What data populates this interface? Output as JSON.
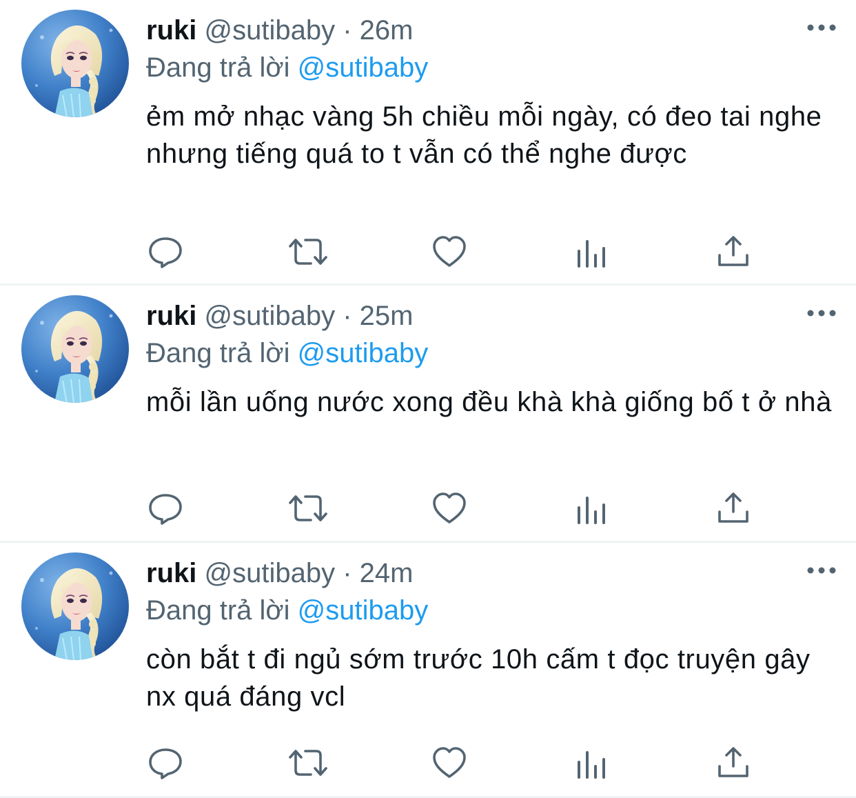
{
  "tweets": [
    {
      "name": "ruki",
      "handle": "@sutibaby",
      "time": "26m",
      "replying_prefix": "Đang trả lời",
      "replying_to": "@sutibaby",
      "text": "ẻm mở nhạc vàng 5h chiều mỗi ngày, có đeo tai nghe nhưng tiếng quá to t vẫn có thể nghe được"
    },
    {
      "name": "ruki",
      "handle": "@sutibaby",
      "time": "25m",
      "replying_prefix": "Đang trả lời",
      "replying_to": "@sutibaby",
      "text": "mỗi lần uống nước xong đều khà khà giống bố t ở nhà"
    },
    {
      "name": "ruki",
      "handle": "@sutibaby",
      "time": "24m",
      "replying_prefix": "Đang trả lời",
      "replying_to": "@sutibaby",
      "text": "còn bắt t đi ngủ sớm trước 10h cấm t đọc truyện gây nx quá đáng vcl"
    }
  ],
  "icons": {
    "more": "more-icon",
    "reply": "reply-icon",
    "retweet": "retweet-icon",
    "like": "heart-icon",
    "views": "views-icon",
    "share": "share-icon"
  },
  "colors": {
    "accent": "#1d9bf0",
    "secondary_text": "#536471",
    "primary_text": "#0f1419",
    "divider": "#eff3f4"
  }
}
